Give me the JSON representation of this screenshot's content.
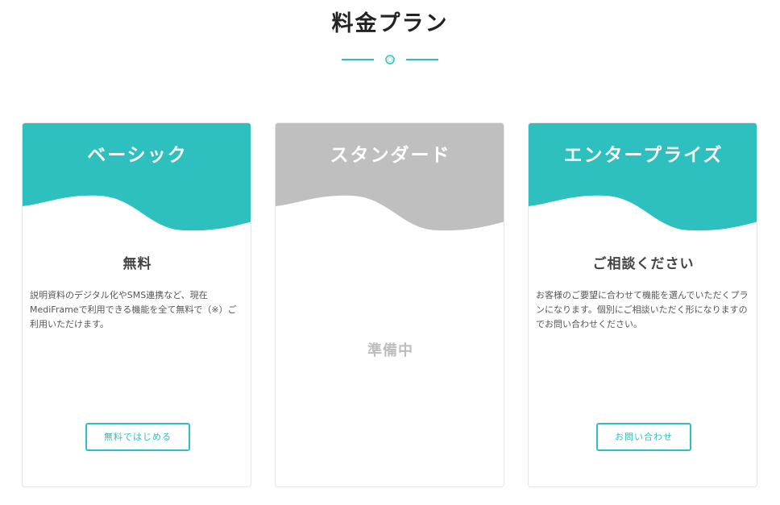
{
  "page": {
    "title": "料金プラン"
  },
  "colors": {
    "accent": "#2ebfbf",
    "inactive_header": "#bfbfbf",
    "inactive_text": "#bdbdbd"
  },
  "plans": [
    {
      "name": "ベーシック",
      "price": "無料",
      "description": "説明資料のデジタル化やSMS連携など、現在MediFrameで利用できる機能を全て無料で（※）ご利用いただけます。",
      "button_label": "無料ではじめる",
      "header_color": "#2ebfbf"
    },
    {
      "name": "スタンダード",
      "status": "準備中",
      "header_color": "#bfbfbf"
    },
    {
      "name": "エンタープライズ",
      "price": "ご相談ください",
      "description": "お客様のご要望に合わせて機能を選んでいただくプランになります。個別にご相談いただく形になりますのでお問い合わせください。",
      "button_label": "お問い合わせ",
      "header_color": "#2ebfbf"
    }
  ]
}
